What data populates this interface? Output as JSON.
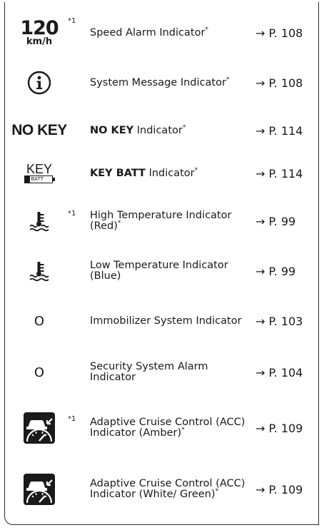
{
  "footnote_marker": "*1",
  "asterisk": "*",
  "rows": [
    {
      "icon": "speed-120-icon",
      "icon_text": "120",
      "icon_unit": "km/h",
      "has_footnote": true,
      "label_plain": "Speed Alarm Indicator",
      "asterisk": true,
      "ref": "→ P. 108"
    },
    {
      "icon": "info-circle-icon",
      "has_footnote": false,
      "label_plain": "System Message Indicator",
      "asterisk": true,
      "ref": "→ P. 108"
    },
    {
      "icon": "no-key-icon",
      "icon_text": "NO KEY",
      "has_footnote": false,
      "label_bold": "NO KEY",
      "label_plain": "Indicator",
      "asterisk": true,
      "ref": "→ P. 114"
    },
    {
      "icon": "key-battery-icon",
      "icon_text": "KEY",
      "icon_sub": "BATT",
      "has_footnote": false,
      "label_bold": "KEY BATT",
      "label_plain": "Indicator",
      "asterisk": true,
      "ref": "→ P. 114"
    },
    {
      "icon": "coolant-temperature-icon",
      "has_footnote": true,
      "label_plain": "High Temperature Indicator (Red)",
      "asterisk": true,
      "ref": "→ P. 99"
    },
    {
      "icon": "coolant-temperature-icon",
      "has_footnote": false,
      "label_plain": "Low Temperature Indicator (Blue)",
      "asterisk": false,
      "ref": "→ P. 99"
    },
    {
      "icon": "small-circle-icon",
      "icon_text": "O",
      "has_footnote": false,
      "label_plain": "Immobilizer System Indicator",
      "asterisk": false,
      "ref": "→ P. 103"
    },
    {
      "icon": "small-circle-icon",
      "icon_text": "O",
      "has_footnote": false,
      "label_plain": "Security System Alarm Indicator",
      "asterisk": false,
      "ref": "→ P. 104"
    },
    {
      "icon": "adaptive-cruise-icon",
      "has_footnote": true,
      "label_plain": "Adaptive Cruise Control (ACC) Indicator (Amber)",
      "asterisk": true,
      "ref": "→ P. 109"
    },
    {
      "icon": "adaptive-cruise-icon",
      "has_footnote": false,
      "label_plain": "Adaptive Cruise Control (ACC) Indicator (White/ Green)",
      "asterisk": true,
      "ref": "→ P. 109"
    }
  ]
}
